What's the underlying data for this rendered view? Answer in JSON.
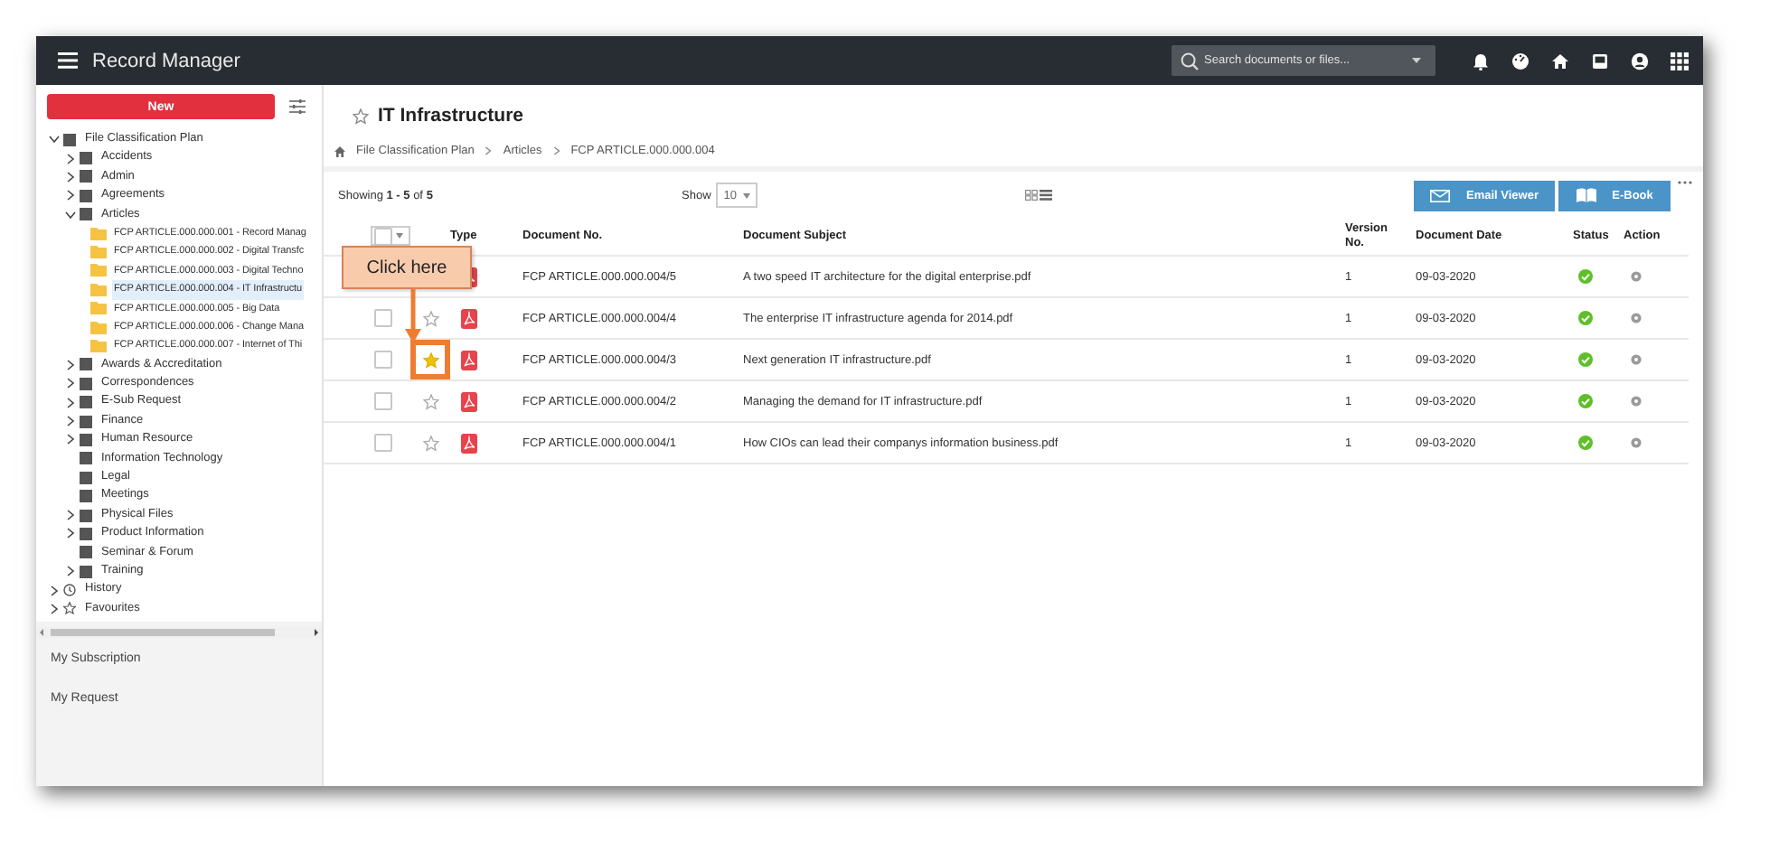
{
  "app": {
    "title": "Record Manager",
    "search_placeholder": "Search documents or files..."
  },
  "sidebar": {
    "new_button": "New",
    "tree": [
      {
        "label": "File Classification Plan",
        "kind": "cabinet",
        "expanded": true,
        "children": [
          {
            "label": "Accidents",
            "kind": "cabinet",
            "expanded": false
          },
          {
            "label": "Admin",
            "kind": "cabinet",
            "expanded": false
          },
          {
            "label": "Agreements",
            "kind": "cabinet",
            "expanded": false
          },
          {
            "label": "Articles",
            "kind": "cabinet",
            "expanded": true,
            "children": [
              {
                "label": "FCP ARTICLE.000.000.001 - Record Manag",
                "kind": "folder",
                "selected": false
              },
              {
                "label": "FCP ARTICLE.000.000.002 - Digital Transfc",
                "kind": "folder",
                "selected": false
              },
              {
                "label": "FCP ARTICLE.000.000.003 - Digital Techno",
                "kind": "folder",
                "selected": false
              },
              {
                "label": "FCP ARTICLE.000.000.004 - IT Infrastructu",
                "kind": "folder",
                "selected": true
              },
              {
                "label": "FCP ARTICLE.000.000.005 - Big Data",
                "kind": "folder",
                "selected": false
              },
              {
                "label": "FCP ARTICLE.000.000.006 - Change Mana",
                "kind": "folder",
                "selected": false
              },
              {
                "label": "FCP ARTICLE.000.000.007 - Internet of Thi",
                "kind": "folder",
                "selected": false
              }
            ]
          },
          {
            "label": "Awards & Accreditation",
            "kind": "cabinet",
            "expanded": false
          },
          {
            "label": "Correspondences",
            "kind": "cabinet",
            "expanded": false
          },
          {
            "label": "E-Sub Request",
            "kind": "cabinet",
            "expanded": false
          },
          {
            "label": "Finance",
            "kind": "cabinet",
            "expanded": false
          },
          {
            "label": "Human Resource",
            "kind": "cabinet",
            "expanded": false
          },
          {
            "label": "Information Technology",
            "kind": "cabinet"
          },
          {
            "label": "Legal",
            "kind": "cabinet"
          },
          {
            "label": "Meetings",
            "kind": "cabinet"
          },
          {
            "label": "Physical Files",
            "kind": "cabinet",
            "expanded": false
          },
          {
            "label": "Product Information",
            "kind": "cabinet",
            "expanded": false
          },
          {
            "label": "Seminar & Forum",
            "kind": "cabinet"
          },
          {
            "label": "Training",
            "kind": "cabinet",
            "expanded": false
          }
        ]
      },
      {
        "label": "History",
        "kind": "clock",
        "expanded": false
      },
      {
        "label": "Favourites",
        "kind": "star",
        "expanded": false
      }
    ],
    "links": [
      "My Subscription",
      "My Request"
    ]
  },
  "page": {
    "title": "IT Infrastructure",
    "breadcrumb": [
      "File Classification Plan",
      "Articles",
      "FCP ARTICLE.000.000.004"
    ],
    "showing": "Showing **1 - 5** of **5**",
    "show_label": "Show",
    "page_size": "10",
    "buttons": [
      {
        "label": "Email Viewer",
        "kind": "mail"
      },
      {
        "label": "E-Book",
        "kind": "book"
      }
    ]
  },
  "table": {
    "all_checked": false,
    "columns": [
      "Type",
      "Document No.",
      "Document Subject",
      "Version No.",
      "Document Date",
      "Status",
      "Action"
    ],
    "rows": [
      {
        "doc_no": "FCP ARTICLE.000.000.004/5",
        "subject": "A two speed IT architecture for the digital enterprise.pdf",
        "version": "1",
        "date": "09-03-2020",
        "highlighted": false
      },
      {
        "doc_no": "FCP ARTICLE.000.000.004/4",
        "subject": "The enterprise IT infrastructure agenda for 2014.pdf",
        "version": "1",
        "date": "09-03-2020",
        "starred": false,
        "checked": false,
        "highlighted": false
      },
      {
        "doc_no": "FCP ARTICLE.000.000.004/3",
        "subject": "Next generation IT infrastructure.pdf",
        "version": "1",
        "date": "09-03-2020",
        "starred": true,
        "checked": false,
        "highlighted": true
      },
      {
        "doc_no": "FCP ARTICLE.000.000.004/2",
        "subject": "Managing the demand for IT infrastructure.pdf",
        "version": "1",
        "date": "09-03-2020",
        "starred": false,
        "checked": false,
        "highlighted": false
      },
      {
        "doc_no": "FCP ARTICLE.000.000.004/1",
        "subject": "How CIOs can lead their companys information business.pdf",
        "version": "1",
        "date": "09-03-2020",
        "starred": false,
        "checked": false,
        "highlighted": false
      }
    ]
  },
  "callout": {
    "text": "Click here"
  }
}
